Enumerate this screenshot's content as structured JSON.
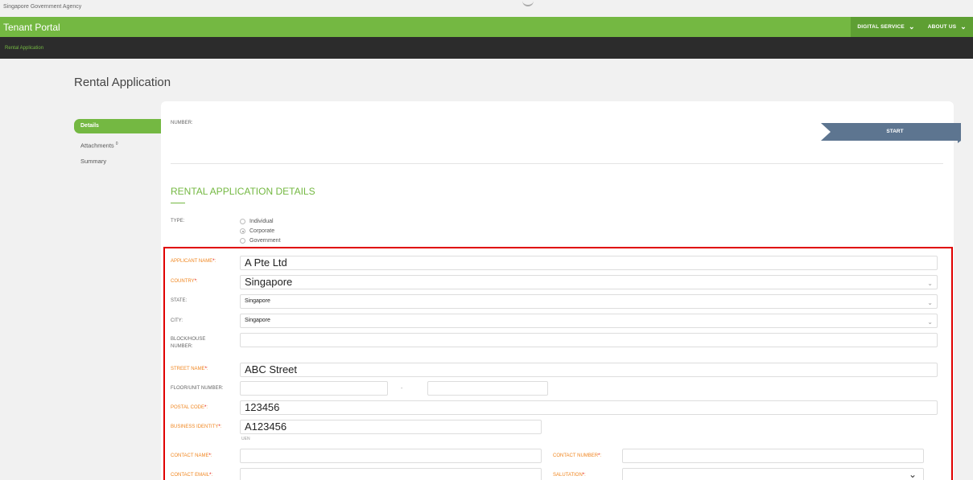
{
  "agency": "Singapore Government Agency",
  "portal_title": "Tenant Portal",
  "nav": [
    {
      "label": "DIGITAL SERVICE"
    },
    {
      "label": "ABOUT US"
    }
  ],
  "breadcrumb": "Rental Application",
  "page_title": "Rental Application",
  "sidebar": {
    "details": "Details",
    "attachments": "Attachments",
    "attachments_count": "0",
    "summary": "Summary"
  },
  "number_label": "NUMBER:",
  "start_label": "START",
  "section_title": "RENTAL APPLICATION DETAILS",
  "type": {
    "label": "TYPE:",
    "options": [
      "Individual",
      "Corporate",
      "Government"
    ],
    "selected": "Corporate"
  },
  "form": {
    "applicant_name": {
      "label": "APPLICANT NAME",
      "value": "A Pte Ltd"
    },
    "country": {
      "label": "COUNTRY",
      "value": "Singapore"
    },
    "state": {
      "label": "STATE:",
      "value": "Singapore"
    },
    "city": {
      "label": "CITY:",
      "value": "Singapore"
    },
    "block": {
      "label": "BLOCK/HOUSE NUMBER:",
      "value": ""
    },
    "street": {
      "label": "STREET NAME",
      "value": "ABC Street"
    },
    "floor_unit": {
      "label": "FLOOR/UNIT NUMBER:",
      "separator": "-"
    },
    "postal": {
      "label": "POSTAL CODE",
      "value": "123456"
    },
    "business_identity": {
      "label": "BUSINESS IDENTITY",
      "value": "A123456",
      "hint": "UEN"
    },
    "contact_name": {
      "label": "CONTACT NAME",
      "value": ""
    },
    "contact_number": {
      "label": "CONTACT NUMBER",
      "value": ""
    },
    "contact_email": {
      "label": "CONTACT EMAIL",
      "value": ""
    },
    "salutation": {
      "label": "SALUTATION",
      "value": ""
    }
  },
  "colors": {
    "brand_green": "#74b842",
    "required_orange": "#f0851e",
    "highlight_red": "#e00000",
    "start_blue": "#5d7590"
  }
}
